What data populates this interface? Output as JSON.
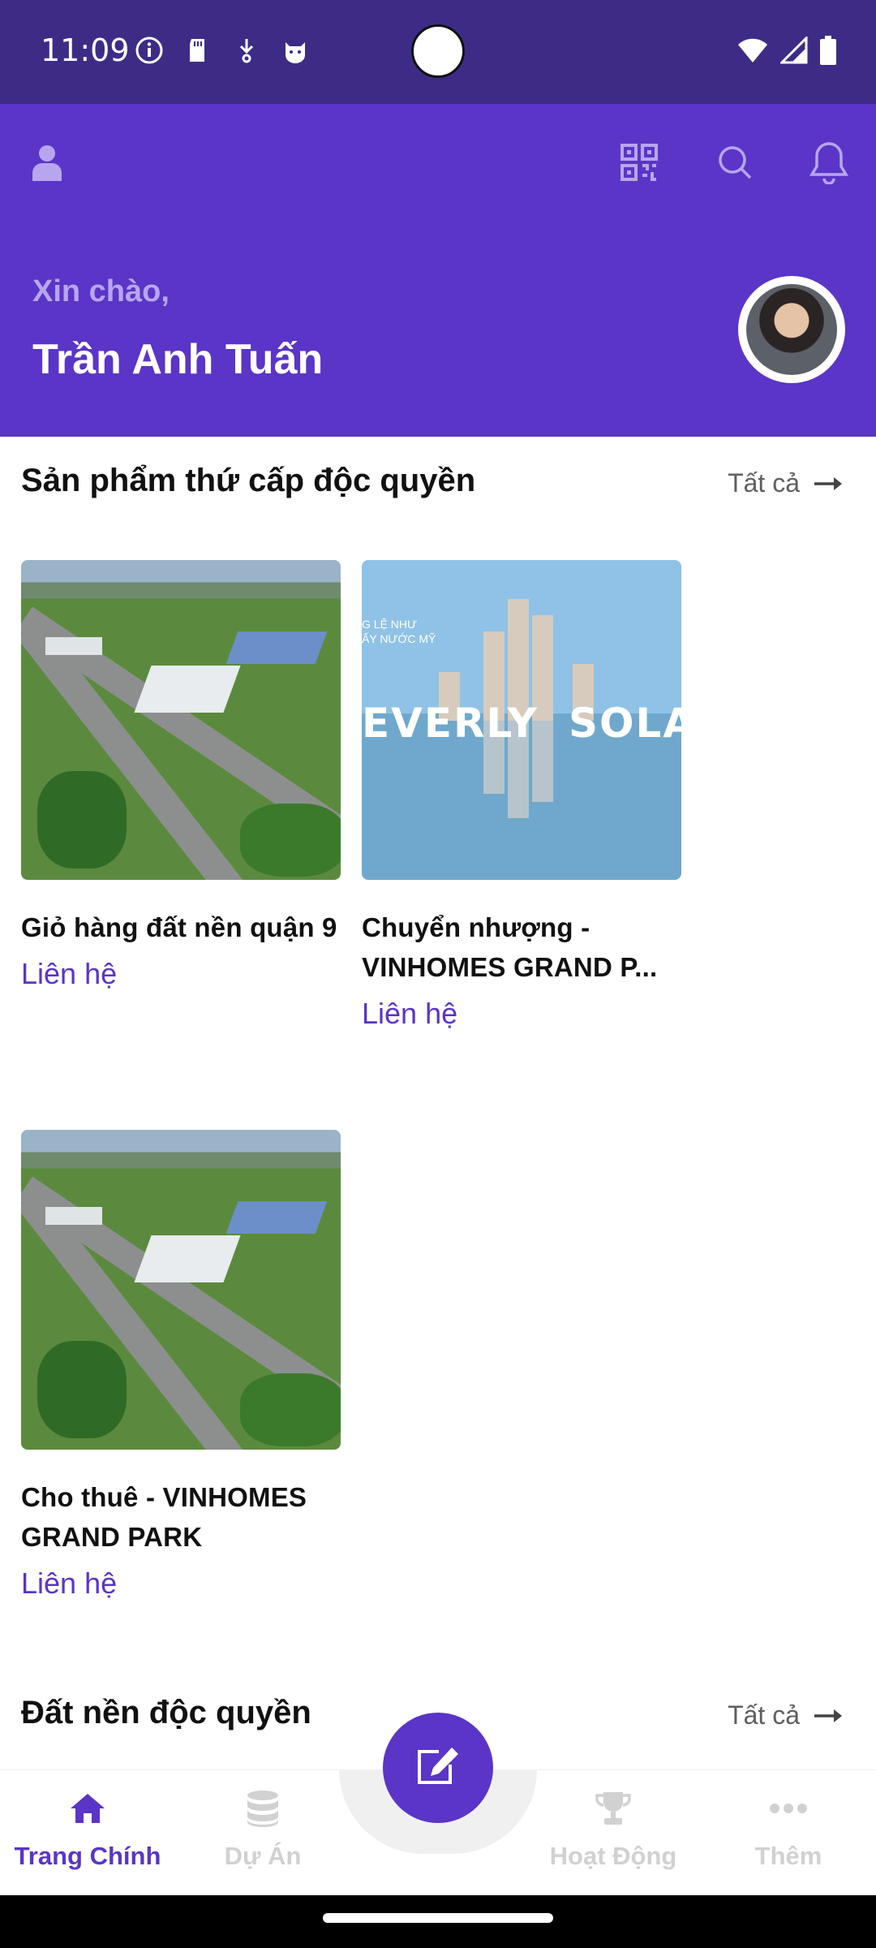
{
  "status_bar": {
    "time": "11:09",
    "icons_left": [
      "info-icon",
      "sd-card-icon",
      "download-icon",
      "cat-icon"
    ],
    "icons_right": [
      "wifi-icon",
      "signal-icon",
      "battery-icon"
    ]
  },
  "header": {
    "icons": [
      "user-icon",
      "qr-code-icon",
      "search-icon",
      "bell-icon"
    ],
    "greeting": "Xin chào,",
    "user_name": "Trần Anh Tuấn",
    "background_color": "#5a35c7"
  },
  "section_secondary": {
    "title": "Sản phẩm thứ cấp độc quyền",
    "see_all": "Tất cả",
    "products": [
      {
        "title": "Giỏ hàng đất nền quận 9",
        "price": "Liên hệ"
      },
      {
        "title": "Chuyển nhượng - VINHOMES GRAND P...",
        "price": "Liên hệ",
        "image_text": [
          "G LỆ NHƯ",
          "ẤY NƯỚC MỸ",
          "EVERLY",
          "SOLAF"
        ]
      },
      {
        "title": "Cho thuê - VINHOMES GRAND PARK",
        "price": "Liên hệ"
      }
    ]
  },
  "section_land": {
    "title": "Đất nền độc quyền",
    "see_all": "Tất cả"
  },
  "bottom_nav": {
    "items": [
      {
        "label": "Trang Chính",
        "icon": "home-icon",
        "active": true
      },
      {
        "label": "Dự Án",
        "icon": "database-icon",
        "active": false
      },
      {
        "label": "Hoạt Động",
        "icon": "trophy-icon",
        "active": false
      },
      {
        "label": "Thêm",
        "icon": "more-icon",
        "active": false
      }
    ],
    "fab_icon": "edit-icon",
    "active_color": "#5a35c7",
    "inactive_color": "#d1d1d1"
  }
}
